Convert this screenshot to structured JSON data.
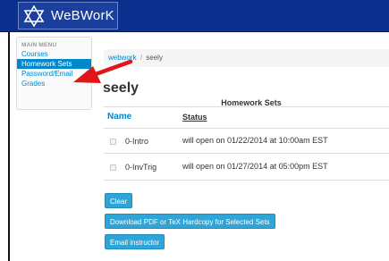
{
  "header": {
    "logo_text": "WeBWorK",
    "logo_icon": "star-of-david-icon",
    "bg_color": "#0a2f8c"
  },
  "sidebar": {
    "title": "MAIN MENU",
    "items": [
      {
        "label": "Courses",
        "active": false
      },
      {
        "label": "Homework Sets",
        "active": true
      },
      {
        "label": "Password/Email",
        "active": false
      },
      {
        "label": "Grades",
        "active": false
      }
    ]
  },
  "breadcrumb": {
    "root": "webwork",
    "separator": "/",
    "current": "seely"
  },
  "page": {
    "title": "seely"
  },
  "table": {
    "caption": "Homework Sets",
    "columns": {
      "name": "Name",
      "status": "Status"
    },
    "rows": [
      {
        "name": "0-Intro",
        "status": "will open on 01/22/2014 at 10:00am EST"
      },
      {
        "name": "0-InvTrig",
        "status": "will open on 01/27/2014 at 05:00pm EST"
      }
    ]
  },
  "buttons": {
    "clear": "Clear",
    "download": "Download PDF or TeX Hardcopy for Selected Sets",
    "email": "Email instructor"
  },
  "colors": {
    "accent": "#0088cc",
    "button": "#2fa4d7",
    "annotation_arrow": "#e0161b"
  }
}
